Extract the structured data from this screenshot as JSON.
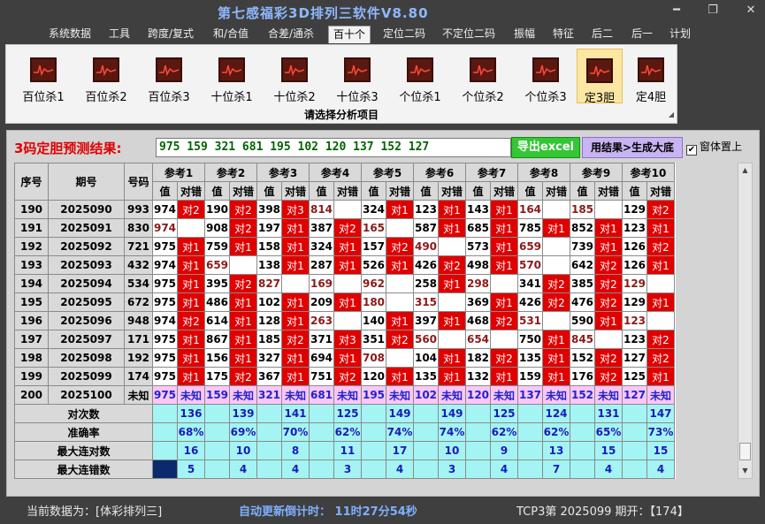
{
  "app": {
    "title": "第七感福彩3D排列三软件V8.80",
    "min": "━",
    "max": "❐",
    "close": "✕"
  },
  "menu": [
    "系统数据",
    "工具",
    "跨度/复式",
    "和/合值",
    "合差/通杀",
    "百十个",
    "定位二码",
    "不定位二码",
    "振幅",
    "特征",
    "后二",
    "后一",
    "计划"
  ],
  "ribbon": {
    "tools": [
      "百位杀1",
      "百位杀2",
      "百位杀3",
      "十位杀1",
      "十位杀2",
      "十位杀3",
      "个位杀1",
      "个位杀2",
      "个位杀3",
      "定3胆",
      "定4胆"
    ],
    "caption": "请选择分析项目"
  },
  "predict": {
    "label": "3码定胆预测结果:",
    "value": "975 159 321 681 195 102 120 137 152 127",
    "export": "导出excel",
    "apply": "用结果>生成大底",
    "topmost": "窗体置上"
  },
  "table": {
    "h_seq": "序号",
    "h_issue": "期号",
    "h_num": "号码",
    "h_val": "值",
    "h_hit": "对错",
    "refs": [
      "参考1",
      "参考2",
      "参考3",
      "参考4",
      "参考5",
      "参考6",
      "参考7",
      "参考8",
      "参考9",
      "参考10"
    ],
    "rows": [
      {
        "s": "190",
        "i": "2025090",
        "n": "993",
        "c": [
          [
            "974",
            "对2",
            "n"
          ],
          [
            "190",
            "对2",
            "n"
          ],
          [
            "398",
            "对3",
            "n"
          ],
          [
            "814",
            "",
            "d"
          ],
          [
            "324",
            "对1",
            "n"
          ],
          [
            "123",
            "对1",
            "n"
          ],
          [
            "143",
            "对1",
            "n"
          ],
          [
            "164",
            "",
            "d"
          ],
          [
            "185",
            "",
            "d"
          ],
          [
            "129",
            "对2",
            "n"
          ]
        ]
      },
      {
        "s": "191",
        "i": "2025091",
        "n": "830",
        "c": [
          [
            "974",
            "",
            "d"
          ],
          [
            "908",
            "对2",
            "n"
          ],
          [
            "197",
            "对1",
            "n"
          ],
          [
            "387",
            "对2",
            "n"
          ],
          [
            "165",
            "",
            "d"
          ],
          [
            "587",
            "对1",
            "n"
          ],
          [
            "685",
            "对1",
            "n"
          ],
          [
            "785",
            "对1",
            "n"
          ],
          [
            "852",
            "对1",
            "n"
          ],
          [
            "123",
            "对1",
            "n"
          ]
        ]
      },
      {
        "s": "192",
        "i": "2025092",
        "n": "721",
        "c": [
          [
            "975",
            "对1",
            "n"
          ],
          [
            "759",
            "对1",
            "n"
          ],
          [
            "158",
            "对1",
            "n"
          ],
          [
            "324",
            "对1",
            "n"
          ],
          [
            "157",
            "对2",
            "n"
          ],
          [
            "490",
            "",
            "d"
          ],
          [
            "573",
            "对1",
            "n"
          ],
          [
            "659",
            "",
            "d"
          ],
          [
            "739",
            "对1",
            "n"
          ],
          [
            "126",
            "对2",
            "n"
          ]
        ]
      },
      {
        "s": "193",
        "i": "2025093",
        "n": "432",
        "c": [
          [
            "974",
            "对1",
            "n"
          ],
          [
            "659",
            "",
            "d"
          ],
          [
            "138",
            "对1",
            "n"
          ],
          [
            "287",
            "对1",
            "n"
          ],
          [
            "526",
            "对1",
            "n"
          ],
          [
            "426",
            "对2",
            "n"
          ],
          [
            "498",
            "对1",
            "n"
          ],
          [
            "570",
            "",
            "d"
          ],
          [
            "642",
            "对2",
            "n"
          ],
          [
            "126",
            "对1",
            "n"
          ]
        ]
      },
      {
        "s": "194",
        "i": "2025094",
        "n": "534",
        "c": [
          [
            "975",
            "对1",
            "n"
          ],
          [
            "395",
            "对2",
            "n"
          ],
          [
            "827",
            "",
            "d"
          ],
          [
            "169",
            "",
            "d"
          ],
          [
            "962",
            "",
            "d"
          ],
          [
            "258",
            "对1",
            "n"
          ],
          [
            "298",
            "",
            "d"
          ],
          [
            "341",
            "对2",
            "n"
          ],
          [
            "385",
            "对2",
            "n"
          ],
          [
            "129",
            "",
            "d"
          ]
        ]
      },
      {
        "s": "195",
        "i": "2025095",
        "n": "672",
        "c": [
          [
            "975",
            "对1",
            "n"
          ],
          [
            "486",
            "对1",
            "n"
          ],
          [
            "102",
            "对1",
            "n"
          ],
          [
            "209",
            "对1",
            "n"
          ],
          [
            "180",
            "",
            "d"
          ],
          [
            "315",
            "",
            "d"
          ],
          [
            "369",
            "对1",
            "n"
          ],
          [
            "426",
            "对2",
            "n"
          ],
          [
            "476",
            "对2",
            "n"
          ],
          [
            "129",
            "对1",
            "n"
          ]
        ]
      },
      {
        "s": "196",
        "i": "2025096",
        "n": "948",
        "c": [
          [
            "974",
            "对2",
            "n"
          ],
          [
            "614",
            "对1",
            "n"
          ],
          [
            "128",
            "对1",
            "n"
          ],
          [
            "263",
            "",
            "d"
          ],
          [
            "140",
            "对1",
            "n"
          ],
          [
            "397",
            "对1",
            "n"
          ],
          [
            "468",
            "对2",
            "n"
          ],
          [
            "531",
            "",
            "d"
          ],
          [
            "590",
            "对1",
            "n"
          ],
          [
            "123",
            "",
            "d"
          ]
        ]
      },
      {
        "s": "197",
        "i": "2025097",
        "n": "171",
        "c": [
          [
            "975",
            "对1",
            "n"
          ],
          [
            "867",
            "对1",
            "n"
          ],
          [
            "185",
            "对2",
            "n"
          ],
          [
            "371",
            "对3",
            "n"
          ],
          [
            "351",
            "对2",
            "n"
          ],
          [
            "560",
            "",
            "d"
          ],
          [
            "654",
            "",
            "d"
          ],
          [
            "750",
            "对1",
            "n"
          ],
          [
            "845",
            "",
            "d"
          ],
          [
            "123",
            "对2",
            "n"
          ]
        ]
      },
      {
        "s": "198",
        "i": "2025098",
        "n": "192",
        "c": [
          [
            "975",
            "对1",
            "n"
          ],
          [
            "156",
            "对1",
            "n"
          ],
          [
            "327",
            "对1",
            "n"
          ],
          [
            "694",
            "对1",
            "n"
          ],
          [
            "708",
            "",
            "d"
          ],
          [
            "104",
            "对1",
            "n"
          ],
          [
            "182",
            "对2",
            "n"
          ],
          [
            "135",
            "对1",
            "n"
          ],
          [
            "152",
            "对2",
            "n"
          ],
          [
            "127",
            "对2",
            "n"
          ]
        ]
      },
      {
        "s": "199",
        "i": "2025099",
        "n": "174",
        "c": [
          [
            "975",
            "对1",
            "n"
          ],
          [
            "175",
            "对2",
            "n"
          ],
          [
            "367",
            "对1",
            "n"
          ],
          [
            "751",
            "对2",
            "n"
          ],
          [
            "120",
            "对1",
            "n"
          ],
          [
            "135",
            "对1",
            "n"
          ],
          [
            "132",
            "对1",
            "n"
          ],
          [
            "159",
            "对1",
            "n"
          ],
          [
            "176",
            "对2",
            "n"
          ],
          [
            "125",
            "对1",
            "n"
          ]
        ]
      }
    ],
    "pred_row": {
      "s": "200",
      "i": "2025100",
      "n": "未知",
      "vals": [
        "975",
        "159",
        "321",
        "681",
        "195",
        "102",
        "120",
        "137",
        "152",
        "127"
      ],
      "unk": "未知"
    },
    "stats": [
      {
        "label": "对次数",
        "vals": [
          "136",
          "139",
          "141",
          "125",
          "149",
          "149",
          "125",
          "124",
          "131",
          "147"
        ]
      },
      {
        "label": "准确率",
        "vals": [
          "68%",
          "69%",
          "70%",
          "62%",
          "74%",
          "74%",
          "62%",
          "62%",
          "65%",
          "73%"
        ]
      },
      {
        "label": "最大连对数",
        "vals": [
          "16",
          "10",
          "8",
          "11",
          "17",
          "10",
          "9",
          "13",
          "15",
          "15"
        ]
      },
      {
        "label": "最大连错数",
        "vals": [
          "5",
          "4",
          "4",
          "3",
          "4",
          "3",
          "4",
          "7",
          "4",
          "4"
        ]
      }
    ]
  },
  "status": {
    "current": "当前数据为：[体彩排列三]",
    "countdown": "自动更新倒计时： 11时27分54秒",
    "period": "TCP3第 2025099 期开：【174】"
  }
}
